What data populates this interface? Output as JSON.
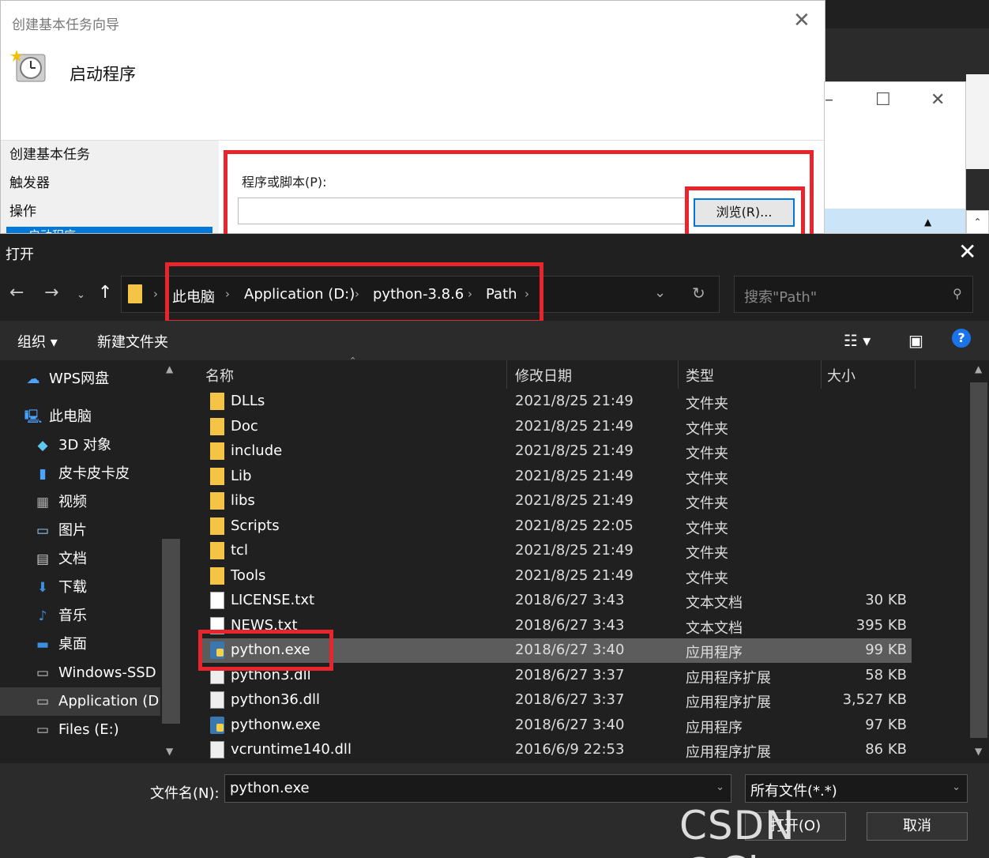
{
  "wizard": {
    "title": "创建基本任务向导",
    "header": "启动程序",
    "steps": [
      "创建基本任务",
      "触发器",
      "操作",
      "启动程序"
    ],
    "program_label": "程序或脚本(P):",
    "program_value": "",
    "browse_label": "浏览(R)..."
  },
  "dialog": {
    "title": "打开",
    "breadcrumb": [
      "此电脑",
      "Application (D:)",
      "python-3.8.6",
      "Path"
    ],
    "search_placeholder": "搜索\"Path\"",
    "toolbar": {
      "organize": "组织 ▾",
      "new_folder": "新建文件夹"
    },
    "columns": {
      "name": "名称",
      "date": "修改日期",
      "type": "类型",
      "size": "大小"
    },
    "sidebar": [
      {
        "label": "WPS网盘",
        "icon": "cloud-icon"
      },
      {
        "label": "此电脑",
        "icon": "computer-icon"
      },
      {
        "label": "3D 对象",
        "icon": "cube-icon"
      },
      {
        "label": "皮卡皮卡皮",
        "icon": "phone-icon"
      },
      {
        "label": "视频",
        "icon": "video-icon"
      },
      {
        "label": "图片",
        "icon": "picture-icon"
      },
      {
        "label": "文档",
        "icon": "document-icon"
      },
      {
        "label": "下载",
        "icon": "download-icon"
      },
      {
        "label": "音乐",
        "icon": "music-icon"
      },
      {
        "label": "桌面",
        "icon": "desktop-icon"
      },
      {
        "label": "Windows-SSD (",
        "icon": "drive-icon"
      },
      {
        "label": "Application (D:)",
        "icon": "drive-icon"
      },
      {
        "label": "Files (E:)",
        "icon": "drive-icon"
      }
    ],
    "files": [
      {
        "name": "DLLs",
        "date": "2021/8/25 21:49",
        "type": "文件夹",
        "size": "",
        "kind": "folder"
      },
      {
        "name": "Doc",
        "date": "2021/8/25 21:49",
        "type": "文件夹",
        "size": "",
        "kind": "folder"
      },
      {
        "name": "include",
        "date": "2021/8/25 21:49",
        "type": "文件夹",
        "size": "",
        "kind": "folder"
      },
      {
        "name": "Lib",
        "date": "2021/8/25 21:49",
        "type": "文件夹",
        "size": "",
        "kind": "folder"
      },
      {
        "name": "libs",
        "date": "2021/8/25 21:49",
        "type": "文件夹",
        "size": "",
        "kind": "folder"
      },
      {
        "name": "Scripts",
        "date": "2021/8/25 22:05",
        "type": "文件夹",
        "size": "",
        "kind": "folder"
      },
      {
        "name": "tcl",
        "date": "2021/8/25 21:49",
        "type": "文件夹",
        "size": "",
        "kind": "folder"
      },
      {
        "name": "Tools",
        "date": "2021/8/25 21:49",
        "type": "文件夹",
        "size": "",
        "kind": "folder"
      },
      {
        "name": "LICENSE.txt",
        "date": "2018/6/27 3:43",
        "type": "文本文档",
        "size": "30 KB",
        "kind": "txt"
      },
      {
        "name": "NEWS.txt",
        "date": "2018/6/27 3:43",
        "type": "文本文档",
        "size": "395 KB",
        "kind": "txt"
      },
      {
        "name": "python.exe",
        "date": "2018/6/27 3:40",
        "type": "应用程序",
        "size": "99 KB",
        "kind": "exe"
      },
      {
        "name": "python3.dll",
        "date": "2018/6/27 3:37",
        "type": "应用程序扩展",
        "size": "58 KB",
        "kind": "dll"
      },
      {
        "name": "python36.dll",
        "date": "2018/6/27 3:37",
        "type": "应用程序扩展",
        "size": "3,527 KB",
        "kind": "dll"
      },
      {
        "name": "pythonw.exe",
        "date": "2018/6/27 3:40",
        "type": "应用程序",
        "size": "97 KB",
        "kind": "exe"
      },
      {
        "name": "vcruntime140.dll",
        "date": "2016/6/9 22:53",
        "type": "应用程序扩展",
        "size": "86 KB",
        "kind": "dll"
      }
    ],
    "selected_file": "python.exe",
    "filename_label": "文件名(N):",
    "filename_value": "python.exe",
    "filter_value": "所有文件(*.*)",
    "open_label": "打开(O)",
    "cancel_label": "取消"
  },
  "watermark": "CSDN @Chorgy",
  "colors": {
    "accent": "#0078d7",
    "highlight_red": "#e8252c",
    "dark_bg": "#202020"
  }
}
